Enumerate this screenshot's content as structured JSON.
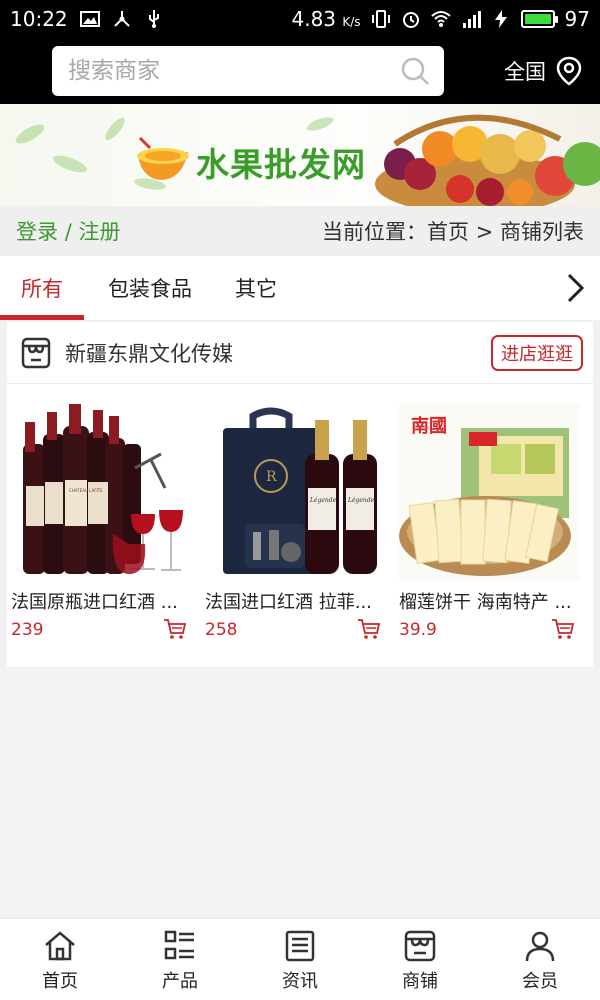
{
  "status": {
    "time": "10:22",
    "speed": "4.83",
    "speed_unit": "K/s",
    "network": "4G",
    "battery": "97"
  },
  "search": {
    "placeholder": "搜索商家"
  },
  "region": {
    "label": "全国"
  },
  "banner": {
    "title": "水果批发网"
  },
  "auth": {
    "login": "登录",
    "separator": "/",
    "register": "注册"
  },
  "breadcrumb": {
    "text": "当前位置：首页 > 商铺列表"
  },
  "tabs": [
    {
      "label": "所有",
      "active": true
    },
    {
      "label": "包装食品",
      "active": false
    },
    {
      "label": "其它",
      "active": false
    }
  ],
  "store": {
    "name": "新疆东鼎文化传媒",
    "visit_label": "进店逛逛",
    "products": [
      {
        "name": "法国原瓶进口红酒 ...",
        "price": "239"
      },
      {
        "name": "法国进口红酒 拉菲...",
        "price": "258"
      },
      {
        "name": "榴莲饼干 海南特产 ...",
        "price": "39.9"
      }
    ],
    "product_image_text": {
      "brand": "南國",
      "wine_label_1": "CHATEAU LAFITE",
      "wine_label_2": "Légende"
    }
  },
  "nav": [
    {
      "label": "首页",
      "icon": "home-icon"
    },
    {
      "label": "产品",
      "icon": "list-icon"
    },
    {
      "label": "资讯",
      "icon": "news-icon"
    },
    {
      "label": "商铺",
      "icon": "shop-icon"
    },
    {
      "label": "会员",
      "icon": "user-icon"
    }
  ],
  "colors": {
    "accent": "#c9252b",
    "green": "#3c9a2f",
    "battery": "#3ddc3d"
  }
}
